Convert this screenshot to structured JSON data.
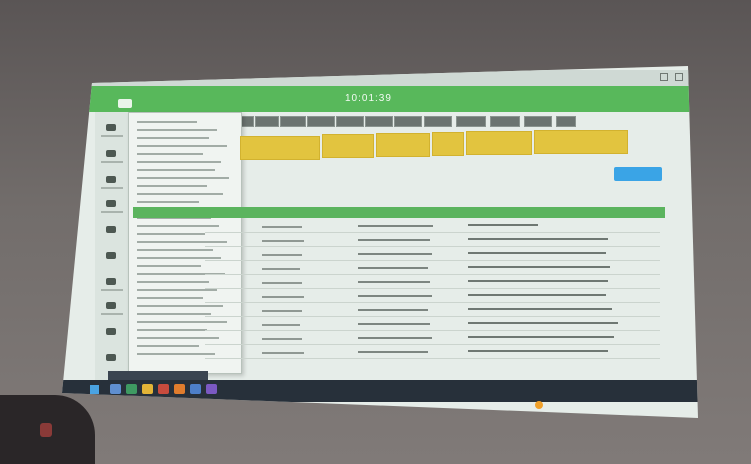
{
  "header": {
    "clock": "10:01:39"
  },
  "colors": {
    "header": "#58b85b",
    "stat_card": "#e2c43f",
    "action_button": "#3aa4e6",
    "table_header": "#5bb45e",
    "taskbar": "#27303a"
  },
  "icons": [
    "windows-logo-icon",
    "weather-icon"
  ]
}
